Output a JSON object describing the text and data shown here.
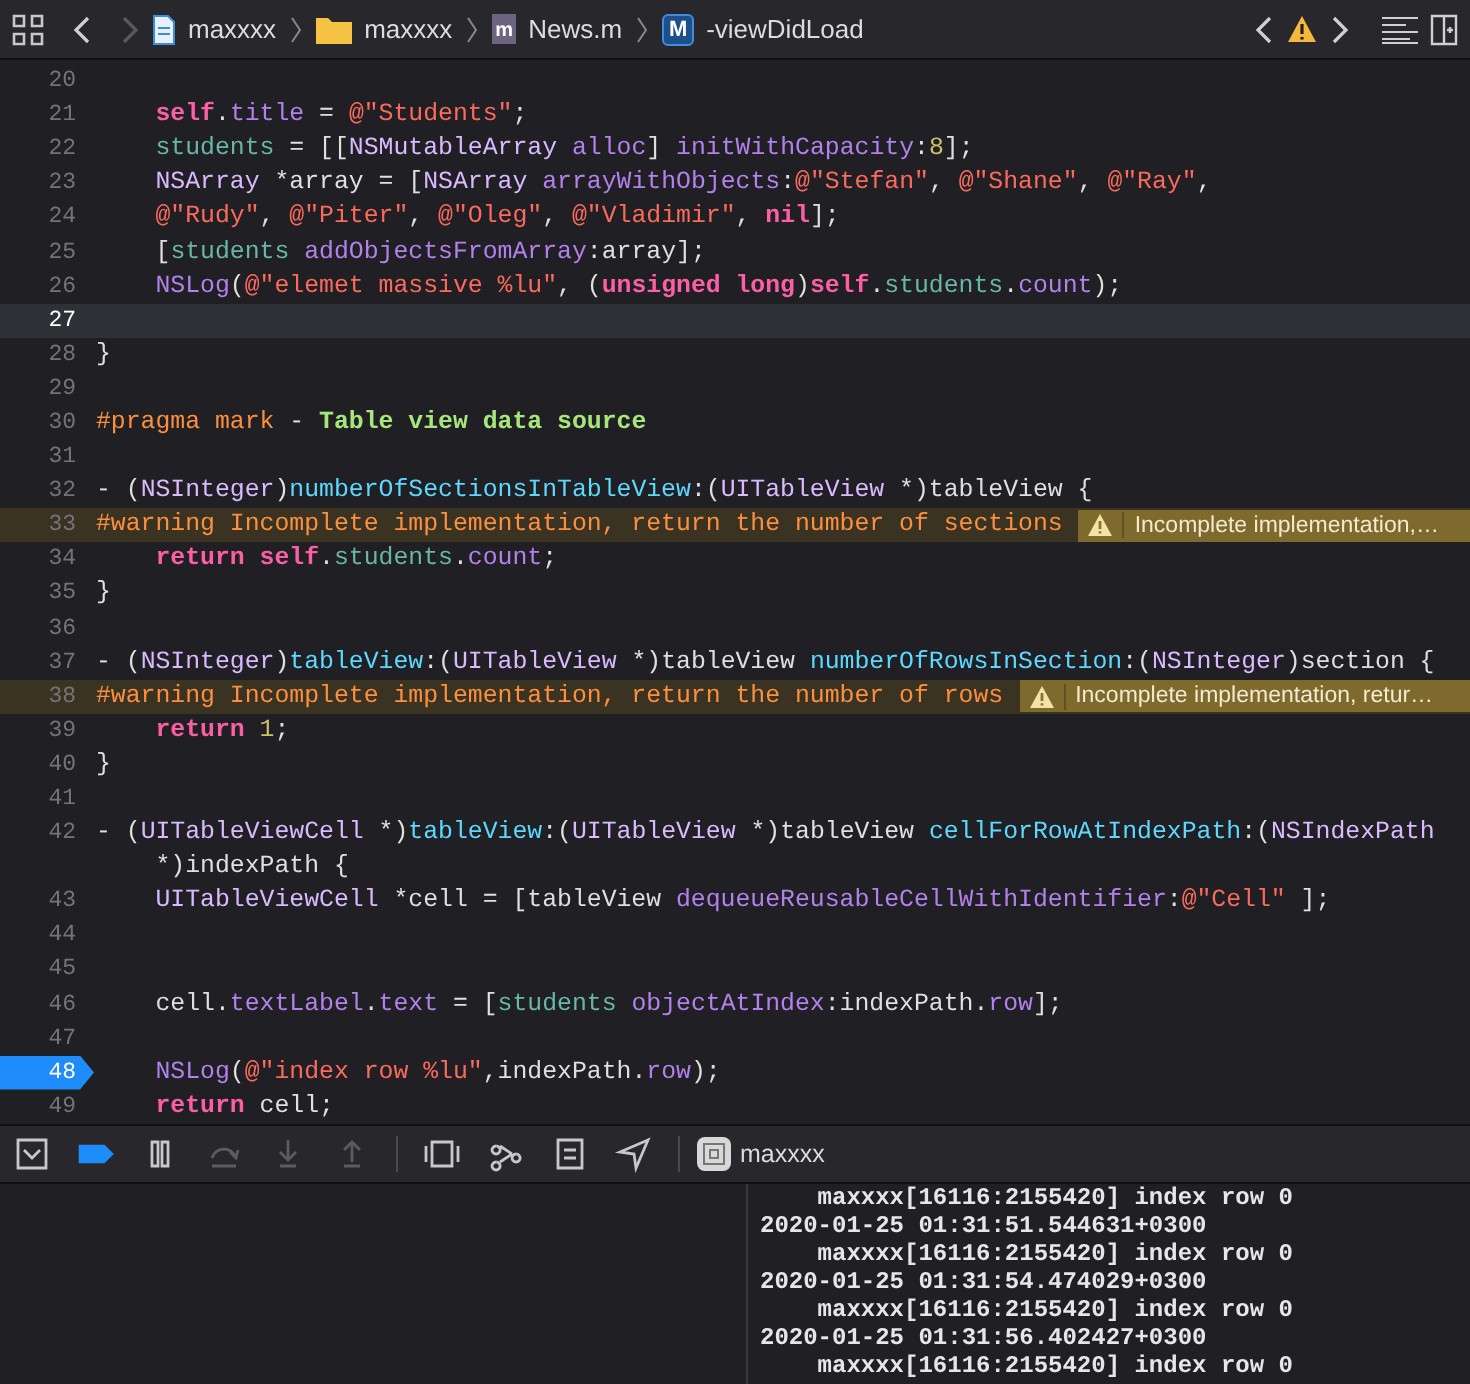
{
  "jump_bar": {
    "back_enabled": true,
    "forward_enabled": false,
    "path": [
      {
        "kind": "project",
        "label": "maxxxx"
      },
      {
        "kind": "folder",
        "label": "maxxxx"
      },
      {
        "kind": "file",
        "label": "News.m",
        "icon_letter": "m"
      },
      {
        "kind": "method",
        "label": "-viewDidLoad",
        "icon_letter": "M"
      }
    ]
  },
  "lines": [
    {
      "number": "20",
      "current": false,
      "breakpoint": false
    },
    {
      "number": "21",
      "current": false,
      "breakpoint": false,
      "tokens": [
        {
          "t": "    **self**",
          "color": "#fc5fa3"
        },
        {
          "t": ".",
          "color": "#dfdfe0"
        },
        {
          "t": "title",
          "color": "#b281eb"
        },
        {
          "t": " = ",
          "color": "#dfdfe0"
        },
        {
          "t": "@\"Students\"",
          "color": "#fc6a5d"
        },
        {
          "t": ";",
          "color": "#dfdfe0"
        }
      ]
    },
    {
      "number": "22",
      "current": false,
      "breakpoint": false,
      "tokens": [
        {
          "t": "    students",
          "color": "#67b7a4"
        },
        {
          "t": " = [[",
          "color": "#dfdfe0"
        },
        {
          "t": "NSMutableArray ",
          "color": "#dabaff"
        },
        {
          "t": "alloc",
          "color": "#b281eb"
        },
        {
          "t": "] ",
          "color": "#dfdfe0"
        },
        {
          "t": "initWithCapacity",
          "color": "#b281eb"
        },
        {
          "t": ":",
          "color": "#dfdfe0"
        },
        {
          "t": "8",
          "color": "#d0bf69"
        },
        {
          "t": "];",
          "color": "#dfdfe0"
        }
      ]
    },
    {
      "number": "23",
      "current": false,
      "breakpoint": false,
      "tokens": [
        {
          "t": "    NSArray",
          "color": "#dabaff"
        },
        {
          "t": " *array = [",
          "color": "#dfdfe0"
        },
        {
          "t": "NSArray ",
          "color": "#dabaff"
        },
        {
          "t": "arrayWithObjects",
          "color": "#b281eb"
        },
        {
          "t": ":",
          "color": "#dfdfe0"
        },
        {
          "t": "@\"Stefan\"",
          "color": "#fc6a5d"
        },
        {
          "t": ", ",
          "color": "#dfdfe0"
        },
        {
          "t": "@\"Shane\"",
          "color": "#fc6a5d"
        },
        {
          "t": ", ",
          "color": "#dfdfe0"
        },
        {
          "t": "@\"Ray\"",
          "color": "#fc6a5d"
        },
        {
          "t": ",",
          "color": "#dfdfe0"
        }
      ]
    },
    {
      "number": "24",
      "current": false,
      "breakpoint": false,
      "tokens": [
        {
          "t": "    @\"Rudy\"",
          "color": "#fc6a5d"
        },
        {
          "t": ", ",
          "color": "#dfdfe0"
        },
        {
          "t": "@\"Piter\"",
          "color": "#fc6a5d"
        },
        {
          "t": ", ",
          "color": "#dfdfe0"
        },
        {
          "t": "@\"Oleg\"",
          "color": "#fc6a5d"
        },
        {
          "t": ", ",
          "color": "#dfdfe0"
        },
        {
          "t": "@\"Vladimir\"",
          "color": "#fc6a5d"
        },
        {
          "t": ", ",
          "color": "#dfdfe0"
        },
        {
          "t": "**nil**",
          "color": "#fc5fa3"
        },
        {
          "t": "];",
          "color": "#dfdfe0"
        }
      ]
    },
    {
      "number": "25",
      "current": false,
      "breakpoint": false,
      "tokens": [
        {
          "t": "    [",
          "color": "#dfdfe0"
        },
        {
          "t": "students ",
          "color": "#67b7a4"
        },
        {
          "t": "addObjectsFromArray",
          "color": "#b281eb"
        },
        {
          "t": ":array];",
          "color": "#dfdfe0"
        }
      ]
    },
    {
      "number": "26",
      "current": false,
      "breakpoint": false,
      "tokens": [
        {
          "t": "    NSLog",
          "color": "#b281eb"
        },
        {
          "t": "(",
          "color": "#dfdfe0"
        },
        {
          "t": "@\"elemet massive %lu\"",
          "color": "#fc6a5d"
        },
        {
          "t": ", (",
          "color": "#dfdfe0"
        },
        {
          "t": "**unsigned long**",
          "color": "#fc5fa3"
        },
        {
          "t": ")",
          "color": "#dfdfe0"
        },
        {
          "t": "**self**",
          "color": "#fc5fa3"
        },
        {
          "t": ".",
          "color": "#dfdfe0"
        },
        {
          "t": "students",
          "color": "#67b7a4"
        },
        {
          "t": ".",
          "color": "#dfdfe0"
        },
        {
          "t": "count",
          "color": "#b281eb"
        },
        {
          "t": ");",
          "color": "#dfdfe0"
        }
      ]
    },
    {
      "number": "27",
      "current": true,
      "breakpoint": false
    },
    {
      "number": "28",
      "current": false,
      "breakpoint": false,
      "tokens": [
        {
          "t": "}",
          "color": "#dfdfe0"
        }
      ]
    },
    {
      "number": "29",
      "current": false,
      "breakpoint": false
    },
    {
      "number": "30",
      "current": false,
      "breakpoint": false,
      "tokens": [
        {
          "t": "#pragma mark",
          "color": "#fd8f3f"
        },
        {
          "t": " - ",
          "color": "#dfdfe0"
        },
        {
          "t": "**Table view data source**",
          "color": "#a6e67a"
        }
      ]
    },
    {
      "number": "31",
      "current": false,
      "breakpoint": false
    },
    {
      "number": "32",
      "current": false,
      "breakpoint": false,
      "tokens": [
        {
          "t": "- (",
          "color": "#dfdfe0"
        },
        {
          "t": "NSInteger",
          "color": "#dabaff"
        },
        {
          "t": ")",
          "color": "#dfdfe0"
        },
        {
          "t": "numberOfSectionsInTableView",
          "color": "#5dd8ff"
        },
        {
          "t": ":(",
          "color": "#dfdfe0"
        },
        {
          "t": "UITableView",
          "color": "#dabaff"
        },
        {
          "t": " *)tableView {",
          "color": "#dfdfe0"
        }
      ]
    },
    {
      "number": "33",
      "current": false,
      "breakpoint": false,
      "tokens": [
        {
          "t": "#warning Incomplete implementation, return the number of sections",
          "color": "#fd8f3f"
        }
      ],
      "warning": "Incomplete implementation,…"
    },
    {
      "number": "34",
      "current": false,
      "breakpoint": false,
      "tokens": [
        {
          "t": "    **return self**",
          "color": "#fc5fa3"
        },
        {
          "t": ".",
          "color": "#dfdfe0"
        },
        {
          "t": "students",
          "color": "#67b7a4"
        },
        {
          "t": ".",
          "color": "#dfdfe0"
        },
        {
          "t": "count",
          "color": "#b281eb"
        },
        {
          "t": ";",
          "color": "#dfdfe0"
        }
      ]
    },
    {
      "number": "35",
      "current": false,
      "breakpoint": false,
      "tokens": [
        {
          "t": "}",
          "color": "#dfdfe0"
        }
      ]
    },
    {
      "number": "36",
      "current": false,
      "breakpoint": false
    },
    {
      "number": "37",
      "current": false,
      "breakpoint": false,
      "tokens": [
        {
          "t": "- (",
          "color": "#dfdfe0"
        },
        {
          "t": "NSInteger",
          "color": "#dabaff"
        },
        {
          "t": ")",
          "color": "#dfdfe0"
        },
        {
          "t": "tableView",
          "color": "#5dd8ff"
        },
        {
          "t": ":(",
          "color": "#dfdfe0"
        },
        {
          "t": "UITableView",
          "color": "#dabaff"
        },
        {
          "t": " *)tableView ",
          "color": "#dfdfe0"
        },
        {
          "t": "numberOfRowsInSection",
          "color": "#5dd8ff"
        },
        {
          "t": ":(",
          "color": "#dfdfe0"
        },
        {
          "t": "NSInteger",
          "color": "#dabaff"
        },
        {
          "t": ")section {",
          "color": "#dfdfe0"
        }
      ]
    },
    {
      "number": "38",
      "current": false,
      "breakpoint": false,
      "tokens": [
        {
          "t": "#warning Incomplete implementation, return the number of rows",
          "color": "#fd8f3f"
        }
      ],
      "warning": "Incomplete implementation, retur…"
    },
    {
      "number": "39",
      "current": false,
      "breakpoint": false,
      "tokens": [
        {
          "t": "    **return**",
          "color": "#fc5fa3"
        },
        {
          "t": " 1",
          "color": "#d0bf69"
        },
        {
          "t": ";",
          "color": "#dfdfe0"
        }
      ]
    },
    {
      "number": "40",
      "current": false,
      "breakpoint": false,
      "tokens": [
        {
          "t": "}",
          "color": "#dfdfe0"
        }
      ]
    },
    {
      "number": "41",
      "current": false,
      "breakpoint": false
    },
    {
      "number": "42",
      "current": false,
      "breakpoint": false,
      "tokens": [
        {
          "t": "- (",
          "color": "#dfdfe0"
        },
        {
          "t": "UITableViewCell",
          "color": "#dabaff"
        },
        {
          "t": " *)",
          "color": "#dfdfe0"
        },
        {
          "t": "tableView",
          "color": "#5dd8ff"
        },
        {
          "t": ":(",
          "color": "#dfdfe0"
        },
        {
          "t": "UITableView",
          "color": "#dabaff"
        },
        {
          "t": " *)tableView ",
          "color": "#dfdfe0"
        },
        {
          "t": "cellForRowAtIndexPath",
          "color": "#5dd8ff"
        },
        {
          "t": ":(",
          "color": "#dfdfe0"
        },
        {
          "t": "NSIndexPath",
          "color": "#dabaff"
        }
      ],
      "wrapped_tokens": [
        {
          "t": "    *)indexPath {",
          "color": "#dfdfe0"
        }
      ]
    },
    {
      "number": "43",
      "current": false,
      "breakpoint": false,
      "tokens": [
        {
          "t": "    UITableViewCell",
          "color": "#dabaff"
        },
        {
          "t": " *cell = [tableView ",
          "color": "#dfdfe0"
        },
        {
          "t": "dequeueReusableCellWithIdentifier",
          "color": "#b281eb"
        },
        {
          "t": ":",
          "color": "#dfdfe0"
        },
        {
          "t": "@\"Cell\"",
          "color": "#fc6a5d"
        },
        {
          "t": " ];",
          "color": "#dfdfe0"
        }
      ]
    },
    {
      "number": "44",
      "current": false,
      "breakpoint": false
    },
    {
      "number": "45",
      "current": false,
      "breakpoint": false
    },
    {
      "number": "46",
      "current": false,
      "breakpoint": false,
      "tokens": [
        {
          "t": "    cell.",
          "color": "#dfdfe0"
        },
        {
          "t": "textLabel",
          "color": "#b281eb"
        },
        {
          "t": ".",
          "color": "#dfdfe0"
        },
        {
          "t": "text",
          "color": "#b281eb"
        },
        {
          "t": " = [",
          "color": "#dfdfe0"
        },
        {
          "t": "students ",
          "color": "#67b7a4"
        },
        {
          "t": "objectAtIndex",
          "color": "#b281eb"
        },
        {
          "t": ":indexPath.",
          "color": "#dfdfe0"
        },
        {
          "t": "row",
          "color": "#b281eb"
        },
        {
          "t": "];",
          "color": "#dfdfe0"
        }
      ]
    },
    {
      "number": "47",
      "current": false,
      "breakpoint": false
    },
    {
      "number": "48",
      "current": false,
      "breakpoint": true,
      "tokens": [
        {
          "t": "    NSLog",
          "color": "#b281eb"
        },
        {
          "t": "(",
          "color": "#dfdfe0"
        },
        {
          "t": "@\"index row %lu\"",
          "color": "#fc6a5d"
        },
        {
          "t": ",indexPath.",
          "color": "#dfdfe0"
        },
        {
          "t": "row",
          "color": "#b281eb"
        },
        {
          "t": ");",
          "color": "#dfdfe0"
        }
      ]
    },
    {
      "number": "49",
      "current": false,
      "breakpoint": false,
      "tokens": [
        {
          "t": "    **return**",
          "color": "#fc5fa3"
        },
        {
          "t": " cell;",
          "color": "#dfdfe0"
        }
      ]
    }
  ],
  "debug_bar": {
    "breakpoints_active": true,
    "buttons": [
      {
        "kind": "console",
        "disabled": false
      },
      {
        "kind": "breakpoints",
        "disabled": false
      },
      {
        "kind": "pause",
        "disabled": false
      },
      {
        "kind": "step-over",
        "disabled": true
      },
      {
        "kind": "step-into",
        "disabled": true
      },
      {
        "kind": "step-out",
        "disabled": true
      },
      {
        "kind": "view-debugger",
        "disabled": false
      },
      {
        "kind": "memory-graph",
        "disabled": false
      },
      {
        "kind": "environment",
        "disabled": false
      },
      {
        "kind": "location",
        "disabled": false
      }
    ],
    "target": "maxxxx"
  },
  "console": [
    "    maxxxx[16116:2155420] index row 0",
    "2020-01-25 01:31:51.544631+0300",
    "    maxxxx[16116:2155420] index row 0",
    "2020-01-25 01:31:54.474029+0300",
    "    maxxxx[16116:2155420] index row 0",
    "2020-01-25 01:31:56.402427+0300",
    "    maxxxx[16116:2155420] index row 0"
  ]
}
